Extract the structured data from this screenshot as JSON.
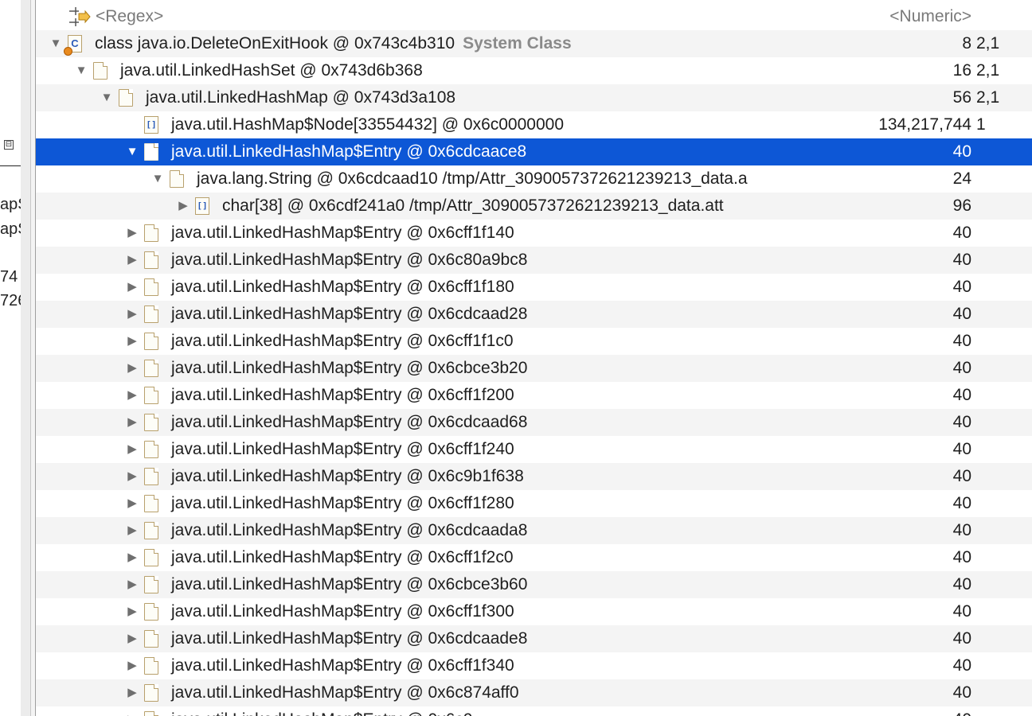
{
  "left_pane": {
    "collapse_glyph": "⊟",
    "fragments": [
      "apS",
      "apS",
      "74",
      "726"
    ]
  },
  "header": {
    "name_filter": "<Regex>",
    "numeric_filter": "<Numeric>"
  },
  "rows": [
    {
      "depth": 0,
      "twisty": "expanded",
      "icon": "class-icon",
      "name": "class java.io.DeleteOnExitHook @ 0x743c4b310",
      "tag": "System Class",
      "shallow": "8",
      "retained": "2,1"
    },
    {
      "depth": 1,
      "twisty": "expanded",
      "icon": "object-icon",
      "name": "java.util.LinkedHashSet @ 0x743d6b368",
      "shallow": "16",
      "retained": "2,1"
    },
    {
      "depth": 2,
      "twisty": "expanded",
      "icon": "object-icon",
      "name": "java.util.LinkedHashMap @ 0x743d3a108",
      "shallow": "56",
      "retained": "2,1"
    },
    {
      "depth": 3,
      "twisty": "none",
      "icon": "array-icon",
      "name": "java.util.HashMap$Node[33554432] @ 0x6c0000000",
      "shallow": "134,217,744",
      "retained": "1"
    },
    {
      "depth": 3,
      "twisty": "expanded",
      "icon": "object-icon",
      "name": "java.util.LinkedHashMap$Entry @ 0x6cdcaace8",
      "shallow": "40",
      "retained": "",
      "selected": true
    },
    {
      "depth": 4,
      "twisty": "expanded",
      "icon": "object-icon",
      "name": "java.lang.String @ 0x6cdcaad10  /tmp/Attr_3090057372621239213_data.a",
      "shallow": "24",
      "retained": ""
    },
    {
      "depth": 5,
      "twisty": "collapsed",
      "icon": "array-icon",
      "name": "char[38] @ 0x6cdf241a0  /tmp/Attr_3090057372621239213_data.att",
      "shallow": "96",
      "retained": ""
    },
    {
      "depth": 3,
      "twisty": "collapsed",
      "icon": "object-icon",
      "name": "java.util.LinkedHashMap$Entry @ 0x6cff1f140",
      "shallow": "40",
      "retained": ""
    },
    {
      "depth": 3,
      "twisty": "collapsed",
      "icon": "object-icon",
      "name": "java.util.LinkedHashMap$Entry @ 0x6c80a9bc8",
      "shallow": "40",
      "retained": ""
    },
    {
      "depth": 3,
      "twisty": "collapsed",
      "icon": "object-icon",
      "name": "java.util.LinkedHashMap$Entry @ 0x6cff1f180",
      "shallow": "40",
      "retained": ""
    },
    {
      "depth": 3,
      "twisty": "collapsed",
      "icon": "object-icon",
      "name": "java.util.LinkedHashMap$Entry @ 0x6cdcaad28",
      "shallow": "40",
      "retained": ""
    },
    {
      "depth": 3,
      "twisty": "collapsed",
      "icon": "object-icon",
      "name": "java.util.LinkedHashMap$Entry @ 0x6cff1f1c0",
      "shallow": "40",
      "retained": ""
    },
    {
      "depth": 3,
      "twisty": "collapsed",
      "icon": "object-icon",
      "name": "java.util.LinkedHashMap$Entry @ 0x6cbce3b20",
      "shallow": "40",
      "retained": ""
    },
    {
      "depth": 3,
      "twisty": "collapsed",
      "icon": "object-icon",
      "name": "java.util.LinkedHashMap$Entry @ 0x6cff1f200",
      "shallow": "40",
      "retained": ""
    },
    {
      "depth": 3,
      "twisty": "collapsed",
      "icon": "object-icon",
      "name": "java.util.LinkedHashMap$Entry @ 0x6cdcaad68",
      "shallow": "40",
      "retained": ""
    },
    {
      "depth": 3,
      "twisty": "collapsed",
      "icon": "object-icon",
      "name": "java.util.LinkedHashMap$Entry @ 0x6cff1f240",
      "shallow": "40",
      "retained": ""
    },
    {
      "depth": 3,
      "twisty": "collapsed",
      "icon": "object-icon",
      "name": "java.util.LinkedHashMap$Entry @ 0x6c9b1f638",
      "shallow": "40",
      "retained": ""
    },
    {
      "depth": 3,
      "twisty": "collapsed",
      "icon": "object-icon",
      "name": "java.util.LinkedHashMap$Entry @ 0x6cff1f280",
      "shallow": "40",
      "retained": ""
    },
    {
      "depth": 3,
      "twisty": "collapsed",
      "icon": "object-icon",
      "name": "java.util.LinkedHashMap$Entry @ 0x6cdcaada8",
      "shallow": "40",
      "retained": ""
    },
    {
      "depth": 3,
      "twisty": "collapsed",
      "icon": "object-icon",
      "name": "java.util.LinkedHashMap$Entry @ 0x6cff1f2c0",
      "shallow": "40",
      "retained": ""
    },
    {
      "depth": 3,
      "twisty": "collapsed",
      "icon": "object-icon",
      "name": "java.util.LinkedHashMap$Entry @ 0x6cbce3b60",
      "shallow": "40",
      "retained": ""
    },
    {
      "depth": 3,
      "twisty": "collapsed",
      "icon": "object-icon",
      "name": "java.util.LinkedHashMap$Entry @ 0x6cff1f300",
      "shallow": "40",
      "retained": ""
    },
    {
      "depth": 3,
      "twisty": "collapsed",
      "icon": "object-icon",
      "name": "java.util.LinkedHashMap$Entry @ 0x6cdcaade8",
      "shallow": "40",
      "retained": ""
    },
    {
      "depth": 3,
      "twisty": "collapsed",
      "icon": "object-icon",
      "name": "java.util.LinkedHashMap$Entry @ 0x6cff1f340",
      "shallow": "40",
      "retained": ""
    },
    {
      "depth": 3,
      "twisty": "collapsed",
      "icon": "object-icon",
      "name": "java.util.LinkedHashMap$Entry @ 0x6c874aff0",
      "shallow": "40",
      "retained": ""
    },
    {
      "depth": 3,
      "twisty": "collapsed",
      "icon": "object-icon",
      "name": "java.util.LinkedHashMap$Entry @ 0x6c9 ...",
      "shallow": "40",
      "retained": ""
    }
  ],
  "colors": {
    "selection": "#0d57d6",
    "alt_row": "#f4f4f4",
    "system_class_tag": "#8a8a8a"
  }
}
